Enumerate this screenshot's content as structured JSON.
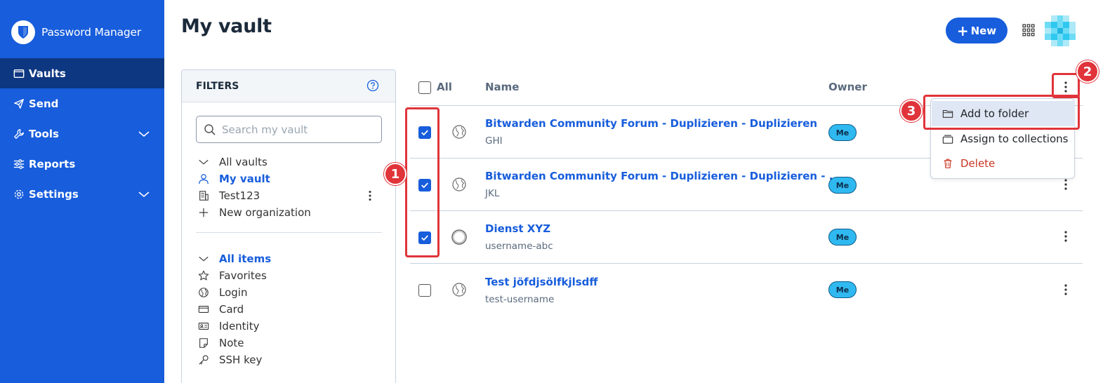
{
  "app": {
    "name": "Password Manager"
  },
  "sidebar": {
    "items": [
      {
        "label": "Vaults",
        "icon": "vault-icon",
        "active": true
      },
      {
        "label": "Send",
        "icon": "send-icon"
      },
      {
        "label": "Tools",
        "icon": "wrench-icon",
        "expandable": true
      },
      {
        "label": "Reports",
        "icon": "sliders-icon"
      },
      {
        "label": "Settings",
        "icon": "gear-icon",
        "expandable": true
      }
    ]
  },
  "header": {
    "title": "My vault",
    "new_button": "New"
  },
  "filters": {
    "title": "FILTERS",
    "search_placeholder": "Search my vault",
    "vaults": [
      {
        "label": "All vaults",
        "icon": "chevron-down-icon"
      },
      {
        "label": "My vault",
        "icon": "user-icon",
        "selected": true
      },
      {
        "label": "Test123",
        "icon": "organization-icon"
      },
      {
        "label": "New organization",
        "icon": "plus-icon"
      }
    ],
    "types": [
      {
        "label": "All items",
        "icon": "chevron-down-icon",
        "selected": true
      },
      {
        "label": "Favorites",
        "icon": "star-icon"
      },
      {
        "label": "Login",
        "icon": "globe-icon"
      },
      {
        "label": "Card",
        "icon": "card-icon"
      },
      {
        "label": "Identity",
        "icon": "id-card-icon"
      },
      {
        "label": "Note",
        "icon": "note-icon"
      },
      {
        "label": "SSH key",
        "icon": "key-icon"
      }
    ]
  },
  "table": {
    "headers": {
      "all": "All",
      "name": "Name",
      "owner": "Owner"
    },
    "rows": [
      {
        "name": "Bitwarden Community Forum - Duplizieren - Duplizieren",
        "sub": "GHI",
        "owner": "Me",
        "checked": true
      },
      {
        "name": "Bitwarden Community Forum - Duplizieren - Duplizieren - ...",
        "sub": "JKL",
        "owner": "Me",
        "checked": true
      },
      {
        "name": "Dienst XYZ",
        "sub": "username-abc",
        "owner": "Me",
        "checked": true
      },
      {
        "name": "Test jöfdjsölfkjlsdff",
        "sub": "test-username",
        "owner": "Me",
        "checked": false
      }
    ]
  },
  "bulk_menu": {
    "items": [
      {
        "label": "Add to folder",
        "icon": "folder-icon"
      },
      {
        "label": "Assign to collections",
        "icon": "collection-icon"
      },
      {
        "label": "Delete",
        "icon": "trash-icon",
        "danger": true
      }
    ]
  },
  "annotations": {
    "one": "1",
    "two": "2",
    "three": "3"
  },
  "colors": {
    "brand": "#175ddc",
    "sidebar_active": "#0e3781",
    "annotation": "#e0343a",
    "badge": "#2fb9f0"
  }
}
